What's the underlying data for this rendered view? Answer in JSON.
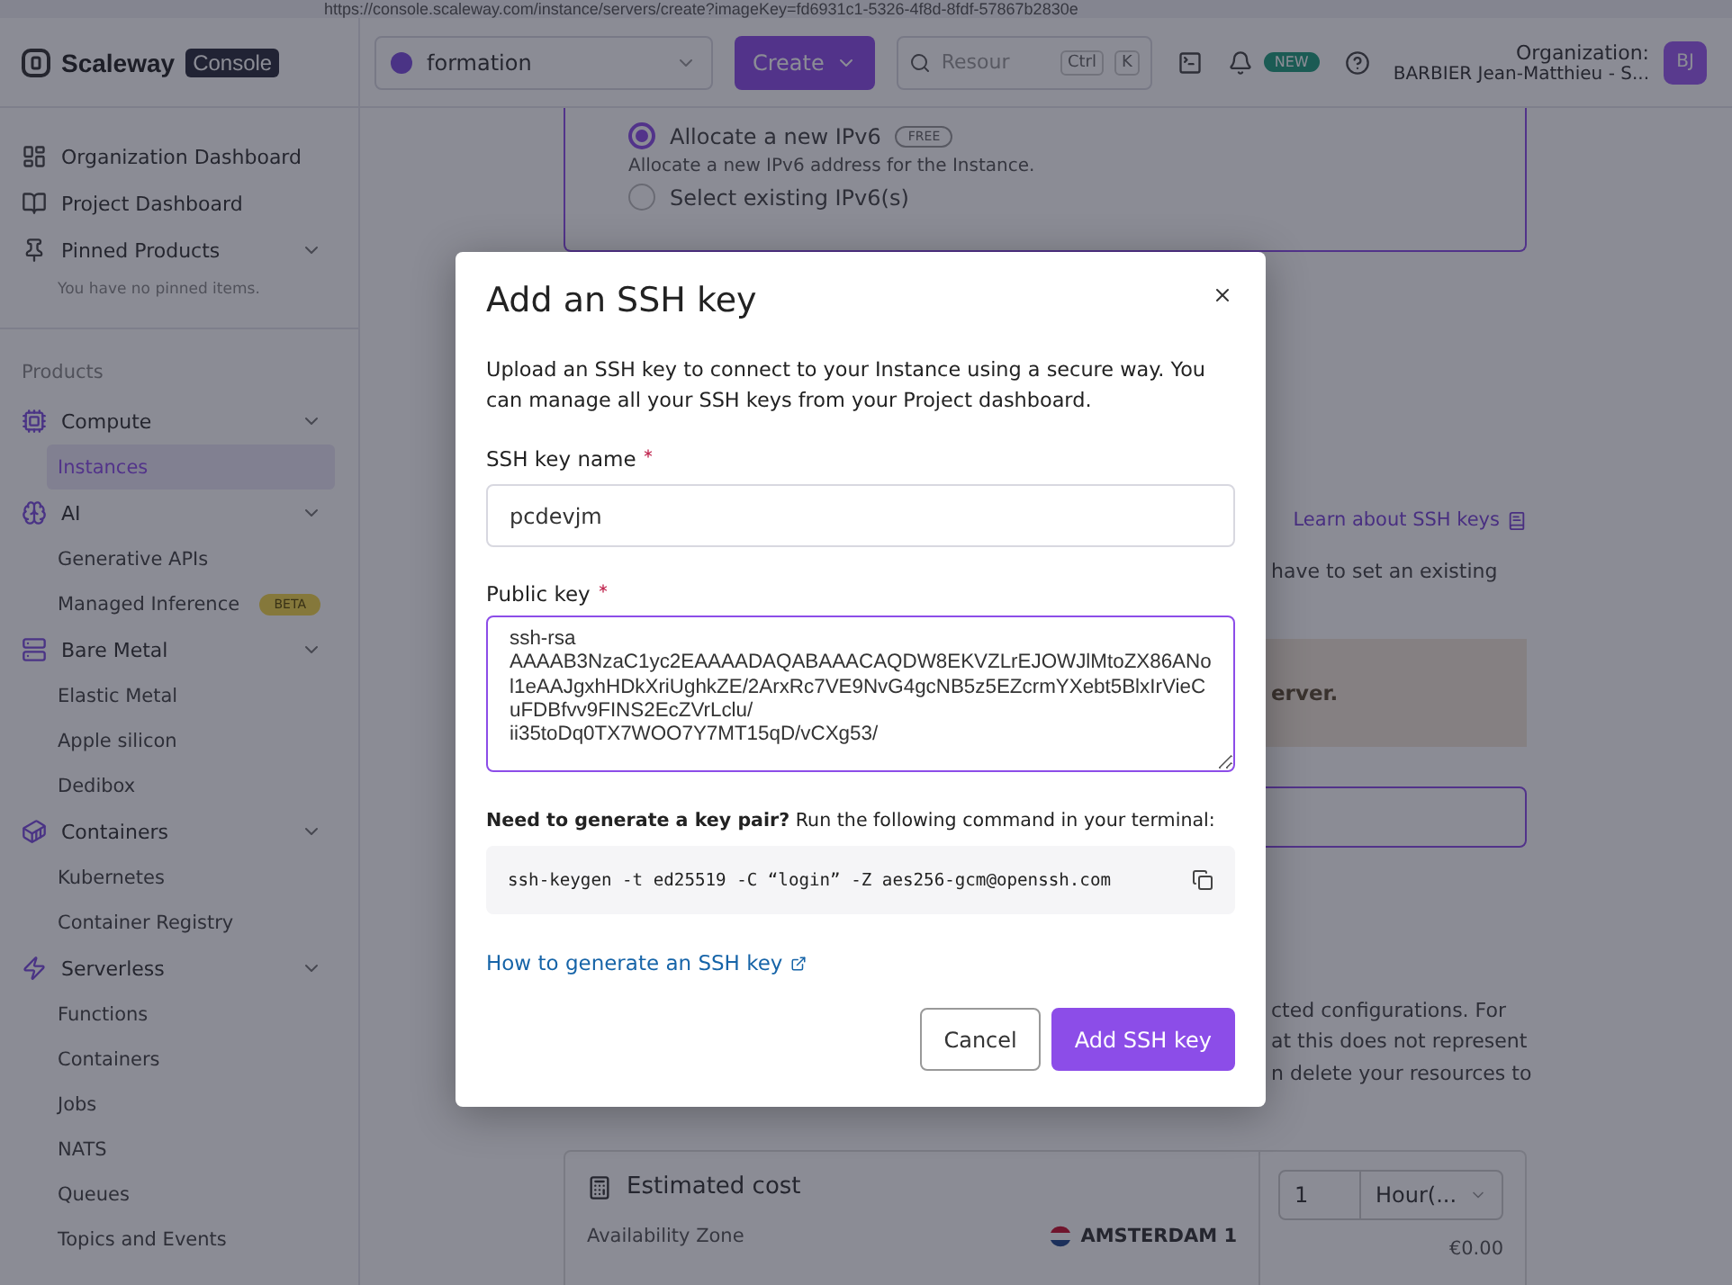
{
  "browser": {
    "url": "https://console.scaleway.com/instance/servers/create?imageKey=fd6931c1-5326-4f8d-8fdf-57867b2830e"
  },
  "topbar": {
    "logo": "Scaleway",
    "logo_badge": "Console",
    "project": "formation",
    "create_button": "Create",
    "search": {
      "placeholder": "Resour",
      "keys": [
        "Ctrl",
        "K"
      ]
    },
    "new_badge": "NEW",
    "org_label": "Organization:",
    "org_name": "BARBIER Jean-Matthieu - S...",
    "avatar": "BJ"
  },
  "sidebar": {
    "top_items": [
      {
        "label": "Organization Dashboard"
      },
      {
        "label": "Project Dashboard"
      },
      {
        "label": "Pinned Products",
        "expanded": true
      }
    ],
    "pinned_empty": "You have no pinned items.",
    "section": "Products",
    "groups": [
      {
        "label": "Compute",
        "expanded": true,
        "children": [
          {
            "label": "Instances",
            "selected": true
          }
        ]
      },
      {
        "label": "AI",
        "expanded": true,
        "children": [
          {
            "label": "Generative APIs",
            "selected": false
          },
          {
            "label": "Managed Inference",
            "selected": false,
            "badge": "BETA"
          }
        ]
      },
      {
        "label": "Bare Metal",
        "expanded": true,
        "children": [
          {
            "label": "Elastic Metal",
            "selected": false
          },
          {
            "label": "Apple silicon",
            "selected": false
          },
          {
            "label": "Dedibox",
            "selected": false
          }
        ]
      },
      {
        "label": "Containers",
        "expanded": true,
        "children": [
          {
            "label": "Kubernetes",
            "selected": false
          },
          {
            "label": "Container Registry",
            "selected": false
          }
        ]
      },
      {
        "label": "Serverless",
        "expanded": true,
        "children": [
          {
            "label": "Functions",
            "selected": false
          },
          {
            "label": "Containers",
            "selected": false
          },
          {
            "label": "Jobs",
            "selected": false
          },
          {
            "label": "NATS",
            "selected": false
          },
          {
            "label": "Queues",
            "selected": false
          },
          {
            "label": "Topics and Events",
            "selected": false
          }
        ]
      }
    ]
  },
  "background": {
    "ipv6_options": [
      {
        "label": "Allocate a new IPv6",
        "selected": true,
        "badge": "FREE"
      },
      {
        "label": "Select existing IPv6(s)",
        "selected": false
      }
    ],
    "ipv6_help": "Allocate a new IPv6 address for the Instance.",
    "ssh_link": "Learn about SSH keys",
    "ssh_text": "have to set an existing",
    "warning_text": "erver.",
    "info_lines": [
      "cted configurations. For",
      "at this does not represent",
      "n delete your resources to"
    ],
    "cost": {
      "title": "Estimated cost",
      "quantity": "1",
      "unit": "Hour(...",
      "zone_label": "Availability Zone",
      "zone": "AMSTERDAM 1",
      "price": "€0.00"
    }
  },
  "modal": {
    "title": "Add an SSH key",
    "description": "Upload an SSH key to connect to your Instance using a secure way. You can manage all your SSH keys from your Project dashboard.",
    "name_field": {
      "label": "SSH key name",
      "required": true,
      "value": "pcdevjm"
    },
    "key_field": {
      "label": "Public key",
      "required": true,
      "value": "ssh-rsa\nAAAAB3NzaC1yc2EAAAADAQABAAACAQDW8EKVZLrEJOWJlMtoZX86ANol1eAAJgxhHDkXriUghkZE/2ArxRc7VE9NvG4gcNB5z5EZcrmYXebt5BlxIrVieCuFDBfvv9FINS2EcZVrLclu/\nii35toDq0TX7WOO7Y7MT15qD/vCXg53/"
    },
    "hint": "**Need to generate a key pair?** Run the following command in your terminal:",
    "command": "ssh-keygen -t ed25519 -C “login” -Z aes256-gcm@openssh.com",
    "help_link": "How to generate an SSH key",
    "cancel_button": "Cancel",
    "submit_button": "Add SSH key"
  }
}
